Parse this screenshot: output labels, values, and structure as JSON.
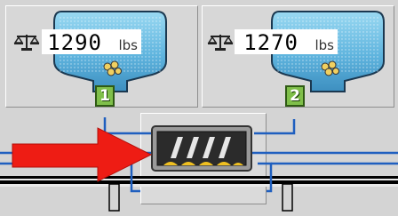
{
  "hoppers": [
    {
      "id": 1,
      "weight": "1290",
      "unit": "lbs",
      "badge": "1"
    },
    {
      "id": 2,
      "weight": "1270",
      "unit": "lbs",
      "badge": "2"
    }
  ],
  "icons": {
    "scale": "balance-scale-icon",
    "material": "pellets-icon",
    "flow": "flow-arrow-icon",
    "mixer": "mixer-icon"
  },
  "colors": {
    "bin_top": "#8fd3f0",
    "bin_bottom": "#3d8fc0",
    "badge": "#7fbf4a",
    "pipe": "#1f5fbf",
    "arrow": "#ee1c14",
    "rail": "#000000",
    "material": "#f0c020"
  }
}
